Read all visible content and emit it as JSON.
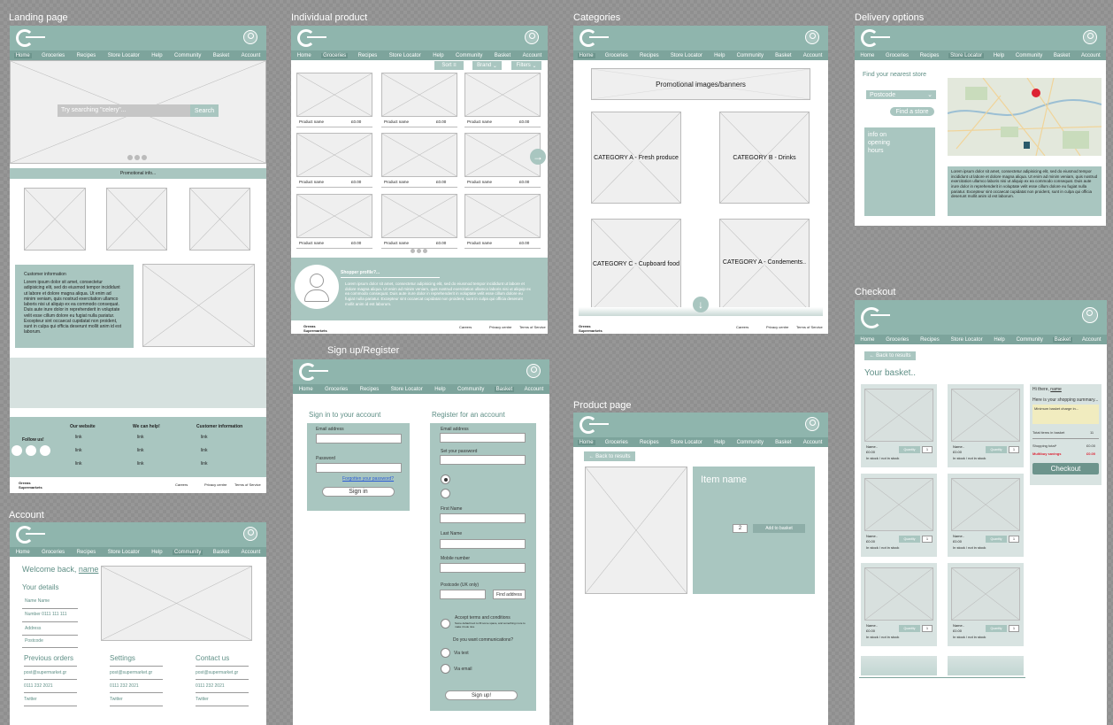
{
  "nav": [
    "Home",
    "Groceries",
    "Recipes",
    "Store Locator",
    "Help",
    "Community",
    "Basket",
    "Account"
  ],
  "titles": {
    "landing": "Landing page",
    "product": "Individual product",
    "categories": "Categories",
    "delivery": "Delivery options",
    "account": "Account",
    "signup": "Sign up/Register",
    "productpage": "Product page",
    "checkout": "Checkout"
  },
  "landing": {
    "search_placeholder": "Try searching \"celery\"...",
    "search_btn": "Search",
    "promo": "Promotional info...",
    "cust_title": "Customer information",
    "cust_body": "Lorem ipsum dolor sit amet, consectetur adipisicing elit, sed do eiusmod tempor incididunt ut labore et dolore magna aliqua. Ut enim ad minim veniam, quis nostrud exercitation ullamco laboris nisi ut aliquip ex ea commodo consequat. Duis aute irure dolor in reprehenderit in voluptate velit esse cillum dolore eu fugiat nulla pariatur. Excepteur sint occaecat cupidatat non proident, sunt in culpa qui officia deserunt mollit anim id est laborum.",
    "follow": "Follow us!",
    "col1": "Our website",
    "col2": "We can help!",
    "col3": "Customer information",
    "l1": [
      "link",
      "link",
      "link"
    ],
    "l2": [
      "link",
      "link",
      "link"
    ],
    "l3": [
      "link",
      "link",
      "link"
    ],
    "brand": "Greeas Supermarkets",
    "careers": "Careers",
    "privacy": "Privacy centre",
    "terms": "Terms of Service"
  },
  "product": {
    "sort": "Sort",
    "brand": "Brand",
    "filters": "Filters",
    "name": "Product name",
    "price": "£0.00",
    "shopper": "Shopper profile?...",
    "shopper_body": "Lorem ipsum dolor sit amet, consectetur adipisicing elit, sed do eiusmod tempor incididunt ut labore et dolore magna aliqua. Ut enim ad minim veniam, quis nostrud exercitation ullamco laboris nisi ut aliquip ex ea commodo consequat. Duis aute irure dolor in reprehenderit in voluptate velit esse cillum dolore eu fugiat nulla pariatur. Excepteur sint occaecat cupidatat non proident, sunt in culpa qui officia deserunt mollit anim id est laborum.",
    "brand_footer": "Greeas Supermarkets",
    "careers": "Careers",
    "privacy": "Privacy centre",
    "terms": "Terms of Service"
  },
  "categories": {
    "banner": "Promotional images/banners",
    "a": "CATEGORY A - Fresh produce",
    "b": "CATEGORY B - Drinks",
    "c": "CATEGORY C - Cupboard food",
    "d": "CATEGORY A - Condements..",
    "brand": "Greeas Supermarkets",
    "careers": "Careers",
    "privacy": "Privacy centre",
    "terms": "Terms of Service"
  },
  "delivery": {
    "find": "Find your nearest store",
    "postcode": "Postcode",
    "find_btn": "Find a store",
    "info": "info on opening hours",
    "body": "Lorem ipsum dolor sit amet, consectetur adipisicing elit, sed do eiusmod tempor incididunt ut labore et dolore magna aliqua. Ut enim ad minim veniam, quis nostrud exercitation ullamco laboris nisi ut aliquip ex ea commodo consequat. Duis aute irure dolor in reprehenderit in voluptate velit esse cillum dolore eu fugiat nulla pariatur. Excepteur sint occaecat cupidatat non proident, sunt in culpa qui officia deserunt mollit anim id est laborum."
  },
  "account": {
    "welcome": "Welcome back,",
    "name": "name",
    "bang": "!",
    "your_details": "Your details",
    "details": [
      "Name Name",
      "Number 0111 111 111",
      "Address",
      "Postcode"
    ],
    "prev": "Previous orders",
    "settings": "Settings",
    "contact": "Contact us",
    "prev_items": [
      "post@supermarket.gr",
      "0111 232 2021",
      "Twitter"
    ],
    "settings_items": [
      "post@supermarket.gr",
      "0111 232 2021",
      "Twitter"
    ],
    "contact_items": [
      "post@supermarket.gr",
      "0111 232 2021",
      "Twitter"
    ]
  },
  "signup": {
    "signin_title": "Sign in to your account",
    "email": "Email address",
    "password": "Password",
    "forgot": "Forgotten your password?",
    "signin_btn": "Sign in",
    "register_title": "Register for an account",
    "set_password": "Set your password",
    "first": "First Name",
    "last": "Last Name",
    "mobile": "Mobile number",
    "postcode": "Postcode (UK only)",
    "find_addr": "Find address",
    "accept": "Accept terms and conditions",
    "accept_note": "Some default text to fill some space, and something more to make it look nice",
    "comms": "Do you want communications?",
    "via_text": "Via text",
    "via_email": "Via email",
    "signup_btn": "Sign up!"
  },
  "productpage": {
    "back": "Back to results",
    "item": "Item name",
    "qty": "2",
    "add": "Add to basket"
  },
  "checkout": {
    "back": "Back to results",
    "basket": "Your basket..",
    "name": "Name..",
    "price": "£0.00",
    "stock": "In stock / not in stock",
    "qty_label": "Quantity",
    "qty": "1",
    "hi": "Hi there,",
    "hi_name": "name",
    "summary": "Here is your shopping summary...",
    "min": "Minimum basket charge in...",
    "total_items": "Total items in basket",
    "total_items_val": "11",
    "shopping_total": "Shopping total*",
    "shopping_total_val": "£0.00",
    "multibuy": "Multibuy savings",
    "multibuy_val": "£0.00",
    "checkout_btn": "Checkout"
  }
}
